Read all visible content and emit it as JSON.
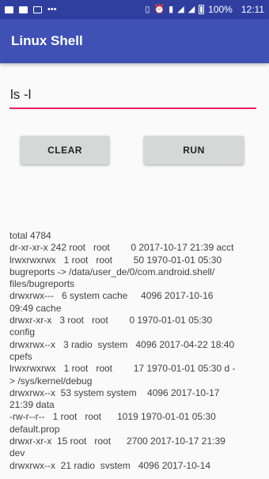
{
  "status_bar": {
    "left_icons": [
      "image-icon",
      "image-icon",
      "notification-icon",
      "more-icon"
    ],
    "battery": "100%",
    "time": "12:11"
  },
  "app": {
    "title": "Linux Shell"
  },
  "command": {
    "value": "ls -l"
  },
  "buttons": {
    "clear": "CLEAR",
    "run": "RUN"
  },
  "output": [
    "total 4784",
    "dr-xr-xr-x 242 root   root        0 2017-10-17 21:39 acct",
    "lrwxrwxrwx   1 root   root        50 1970-01-01 05:30",
    "bugreports -> /data/user_de/0/com.android.shell/",
    "files/bugreports",
    "drwxrwx---   6 system cache     4096 2017-10-16",
    "09:49 cache",
    "drwxr-xr-x   3 root   root        0 1970-01-01 05:30",
    "config",
    "drwxrwx--x   3 radio  system   4096 2017-04-22 18:40",
    "cpefs",
    "lrwxrwxrwx   1 root   root        17 1970-01-01 05:30 d -",
    "> /sys/kernel/debug",
    "drwxrwx--x  53 system system    4096 2017-10-17",
    "21:39 data",
    "-rw-r--r--   1 root   root      1019 1970-01-01 05:30",
    "default.prop",
    "drwxr-xr-x  15 root   root      2700 2017-10-17 21:39",
    "dev",
    "drwxrwx--x  21 radio  system   4096 2017-10-14"
  ]
}
